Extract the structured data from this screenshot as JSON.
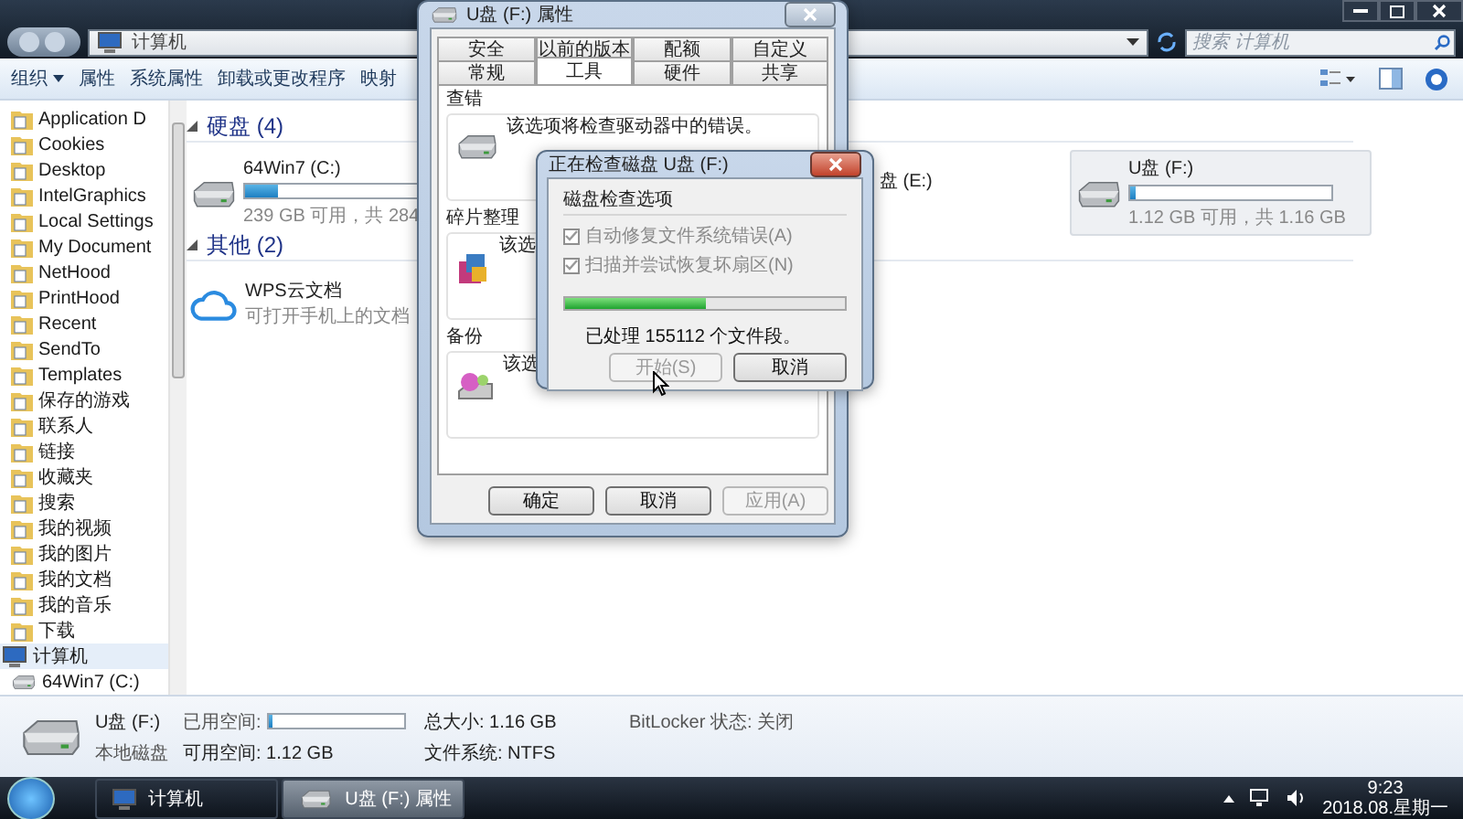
{
  "explorer": {
    "address": [
      "计算机"
    ],
    "search": {
      "placeholder": "搜索 计算机"
    },
    "toolbar": [
      {
        "label": "组织",
        "kind": "menu"
      },
      {
        "label": "属性",
        "kind": "plain"
      },
      {
        "label": "系统属性",
        "kind": "plain"
      },
      {
        "label": "卸载或更改程序",
        "kind": "plain"
      },
      {
        "label": "映射",
        "kind": "plain"
      }
    ],
    "sidebar": {
      "items": [
        {
          "label": "Application D",
          "kind": "folder",
          "selected": false
        },
        {
          "label": "Cookies",
          "kind": "folder",
          "selected": false
        },
        {
          "label": "Desktop",
          "kind": "folder",
          "selected": false
        },
        {
          "label": "IntelGraphics",
          "kind": "folder",
          "selected": false
        },
        {
          "label": "Local Settings",
          "kind": "folder",
          "selected": false
        },
        {
          "label": "My Document",
          "kind": "folder",
          "selected": false
        },
        {
          "label": "NetHood",
          "kind": "folder",
          "selected": false
        },
        {
          "label": "PrintHood",
          "kind": "folder",
          "selected": false
        },
        {
          "label": "Recent",
          "kind": "folder",
          "selected": false
        },
        {
          "label": "SendTo",
          "kind": "folder",
          "selected": false
        },
        {
          "label": "Templates",
          "kind": "folder",
          "selected": false
        },
        {
          "label": "保存的游戏",
          "kind": "folder",
          "selected": false
        },
        {
          "label": "联系人",
          "kind": "folder",
          "selected": false
        },
        {
          "label": "链接",
          "kind": "folder",
          "selected": false
        },
        {
          "label": "收藏夹",
          "kind": "folder",
          "selected": false
        },
        {
          "label": "搜索",
          "kind": "folder",
          "selected": false
        },
        {
          "label": "我的视频",
          "kind": "folder",
          "selected": false
        },
        {
          "label": "我的图片",
          "kind": "folder",
          "selected": false
        },
        {
          "label": "我的文档",
          "kind": "folder",
          "selected": false
        },
        {
          "label": "我的音乐",
          "kind": "folder",
          "selected": false
        },
        {
          "label": "下载",
          "kind": "folder",
          "selected": false
        },
        {
          "label": "计算机",
          "kind": "computer",
          "selected": true
        },
        {
          "label": "64Win7  (C:)",
          "kind": "drive",
          "selected": false
        }
      ]
    },
    "groups": [
      {
        "title": "硬盘 (4)",
        "expanded": true,
        "items": [
          {
            "kind": "drive",
            "name": "64Win7  (C:)",
            "level": 0.16,
            "info": "239 GB 可用，共 284",
            "selected": false
          },
          {
            "kind": "hidden",
            "name": "盘 (E:)"
          },
          {
            "kind": "drive",
            "name": "U盘 (F:)",
            "level": 0.03,
            "info": "1.12 GB 可用，共 1.16 GB",
            "selected": true
          }
        ]
      },
      {
        "title": "其他 (2)",
        "expanded": true,
        "items": [
          {
            "kind": "cloud",
            "name": "WPS云文档",
            "info": "可打开手机上的文档"
          }
        ]
      }
    ],
    "details": {
      "name": "U盘 (F:)",
      "type": "本地磁盘",
      "used_label": "已用空间:",
      "level": 0.03,
      "free": "可用空间: 1.12 GB",
      "total": "总大小: 1.16 GB",
      "fs": "文件系统: NTFS",
      "bitlocker": "BitLocker 状态: 关闭"
    }
  },
  "properties": {
    "title": "U盘 (F:) 属性",
    "tab_rows": [
      {
        "tabs": [
          {
            "label": "安全",
            "selected": false
          },
          {
            "label": "以前的版本",
            "selected": false
          },
          {
            "label": "配额",
            "selected": false
          },
          {
            "label": "自定义",
            "selected": false
          }
        ]
      },
      {
        "tabs": [
          {
            "label": "常规",
            "selected": false
          },
          {
            "label": "工具",
            "selected": true
          },
          {
            "label": "硬件",
            "selected": false
          },
          {
            "label": "共享",
            "selected": false
          }
        ]
      }
    ],
    "sections": [
      {
        "title": "查错",
        "kind": "check",
        "text": "该选项将检查驱动器中的错误。"
      },
      {
        "title": "碎片整理",
        "kind": "defrag",
        "text": "该选"
      },
      {
        "title": "备份",
        "kind": "backup",
        "text": "该选"
      }
    ],
    "buttons": [
      {
        "label": "确定",
        "disabled": false
      },
      {
        "label": "取消",
        "disabled": false
      },
      {
        "label": "应用(A)",
        "disabled": true
      }
    ]
  },
  "checkdisk": {
    "title": "正在检查磁盘 U盘 (F:)",
    "group": "磁盘检查选项",
    "options": [
      {
        "label": "自动修复文件系统错误(A)",
        "checked": true,
        "disabled": true
      },
      {
        "label": "扫描并尝试恢复坏扇区(N)",
        "checked": true,
        "disabled": true
      }
    ],
    "progress": {
      "level": 0.5
    },
    "status": "已处理 155112 个文件段。",
    "buttons": [
      {
        "label": "开始(S)",
        "disabled": true
      },
      {
        "label": "取消",
        "disabled": false
      }
    ]
  },
  "taskbar": {
    "buttons": [
      {
        "label": "计算机",
        "kind": "computer",
        "selected": false
      },
      {
        "label": "U盘 (F:) 属性",
        "kind": "drive",
        "selected": true
      }
    ],
    "time": "9:23",
    "date": "2018.08.星期一"
  }
}
